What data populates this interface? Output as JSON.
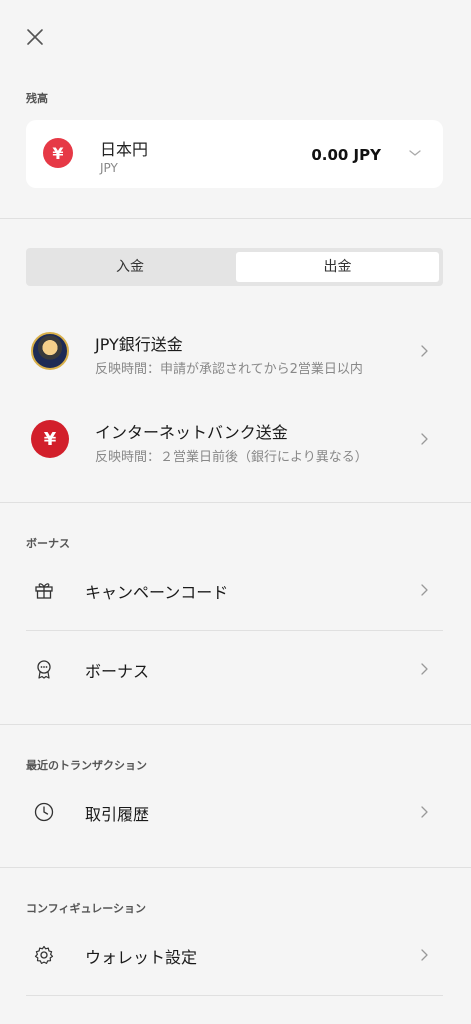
{
  "balance": {
    "section_label": "残高",
    "currency_symbol": "¥",
    "currency_name": "日本円",
    "currency_code": "JPY",
    "amount": "0.00 JPY"
  },
  "tabs": {
    "deposit": "入金",
    "withdraw": "出金",
    "selected": "withdraw"
  },
  "methods": [
    {
      "title": "JPY銀行送金",
      "subtitle": "反映時間：申請が承認されてから2営業日以内",
      "icon": "bank-avatar-icon"
    },
    {
      "title": "インターネットバンク送金",
      "subtitle": "反映時間：２営業日前後（銀行により異なる）",
      "icon": "yen-icon",
      "icon_symbol": "¥"
    }
  ],
  "bonus": {
    "section_label": "ボーナス",
    "items": [
      {
        "label": "キャンペーンコード",
        "icon": "gift-icon"
      },
      {
        "label": "ボーナス",
        "icon": "badge-icon"
      }
    ]
  },
  "transactions": {
    "section_label": "最近のトランザクション",
    "items": [
      {
        "label": "取引履歴",
        "icon": "clock-icon"
      }
    ]
  },
  "config": {
    "section_label": "コンフィギュレーション",
    "items": [
      {
        "label": "ウォレット設定",
        "icon": "gear-icon"
      }
    ]
  },
  "colors": {
    "background": "#f5f5f5",
    "card": "#ffffff",
    "accent_red": "#e63946"
  }
}
